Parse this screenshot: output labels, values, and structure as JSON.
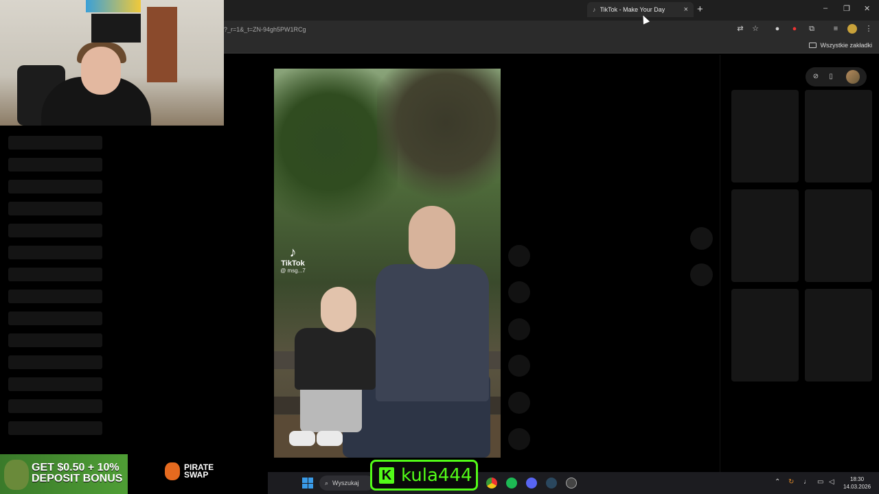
{
  "browser": {
    "tab_title": "TikTok - Make Your Day",
    "tab_close": "×",
    "new_tab": "+",
    "url": "?_r=1&_t=ZN-94gh5PW1RCg",
    "bookmarks_all": "Wszystkie zakładki",
    "window_controls": [
      "–",
      "❐",
      "✕"
    ]
  },
  "video": {
    "watermark_brand": "TikTok",
    "watermark_handle": "@ msg...7"
  },
  "overlay": {
    "ad_line1": "GET $0.50 + 10%",
    "ad_line2": "DEPOSIT BONUS",
    "brand_line1": "PIRATE",
    "brand_line2": "SWAP",
    "kick_username": "kula444",
    "kick_logo": "K"
  },
  "taskbar": {
    "search_placeholder": "Wyszukaj",
    "time": "18:30",
    "date": "14.03.2026"
  },
  "colors": {
    "kick_green": "#53fc18",
    "accent_windows": "#3a9be8"
  }
}
